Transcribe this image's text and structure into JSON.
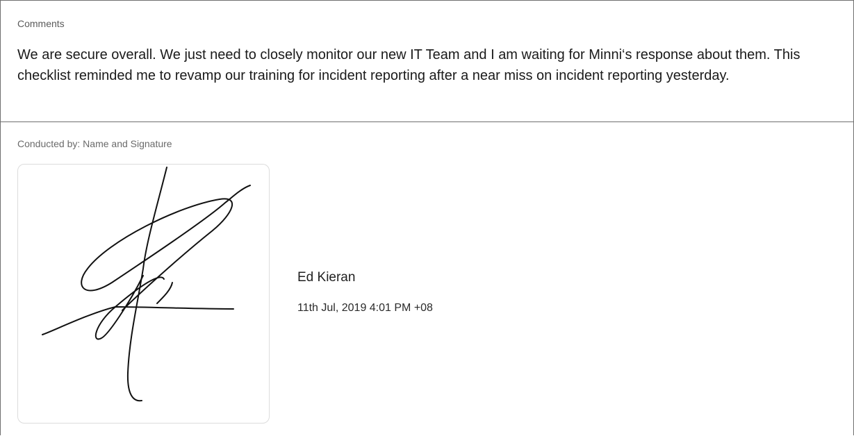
{
  "comments": {
    "label": "Comments",
    "text": "We are secure overall. We just need to closely monitor our new IT Team and I am waiting for Minni‘s response about them. This checklist reminded me to revamp our training for incident reporting after a near miss on incident reporting yesterday."
  },
  "signature_section": {
    "label": "Conducted by: Name and Signature",
    "signer_name": "Ed Kieran",
    "timestamp": "11th Jul, 2019 4:01 PM +08"
  },
  "colors": {
    "border": "#6f6f6f",
    "signature_box_border": "#dcdcdc",
    "ink": "#111111"
  }
}
